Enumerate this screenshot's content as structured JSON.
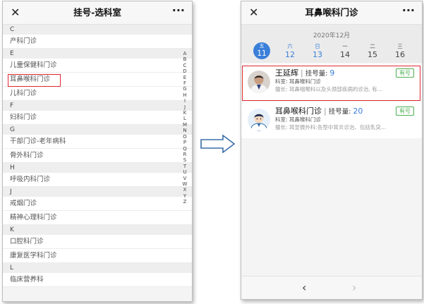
{
  "left": {
    "title": "挂号-选科室",
    "close_icon": "✕",
    "more_icon": "···",
    "rows": [
      {
        "kind": "letter",
        "text": "C"
      },
      {
        "kind": "dept",
        "text": "产科门诊"
      },
      {
        "kind": "letter",
        "text": "E"
      },
      {
        "kind": "dept",
        "text": "儿童保健科门诊"
      },
      {
        "kind": "dept",
        "text": "耳鼻喉科门诊",
        "highlighted": true
      },
      {
        "kind": "dept",
        "text": "儿科门诊"
      },
      {
        "kind": "letter",
        "text": "F"
      },
      {
        "kind": "dept",
        "text": "妇科门诊"
      },
      {
        "kind": "letter",
        "text": "G"
      },
      {
        "kind": "dept",
        "text": "干部门诊-老年病科"
      },
      {
        "kind": "dept",
        "text": "骨外科门诊"
      },
      {
        "kind": "letter",
        "text": "H"
      },
      {
        "kind": "dept",
        "text": "呼吸内科门诊"
      },
      {
        "kind": "letter",
        "text": "J"
      },
      {
        "kind": "dept",
        "text": "戒烟门诊"
      },
      {
        "kind": "dept",
        "text": "精神心理科门诊"
      },
      {
        "kind": "letter",
        "text": "K"
      },
      {
        "kind": "dept",
        "text": "口腔科门诊"
      },
      {
        "kind": "dept",
        "text": "康复医学科门诊"
      },
      {
        "kind": "letter",
        "text": "L"
      },
      {
        "kind": "dept",
        "text": "临床营养科"
      }
    ],
    "alphabet": [
      "A",
      "B",
      "C",
      "D",
      "E",
      "F",
      "G",
      "H",
      "I",
      "J",
      "K",
      "L",
      "M",
      "N",
      "O",
      "P",
      "Q",
      "R",
      "S",
      "T",
      "U",
      "V",
      "W",
      "X",
      "Y",
      "Z"
    ]
  },
  "right": {
    "title": "耳鼻喉科门诊",
    "close_icon": "✕",
    "more_icon": "···",
    "year_month": "2020年12月",
    "days": [
      {
        "weekday": "五",
        "date": "11",
        "state": "active"
      },
      {
        "weekday": "六",
        "date": "12",
        "state": "blue"
      },
      {
        "weekday": "日",
        "date": "13",
        "state": "blue"
      },
      {
        "weekday": "一",
        "date": "14",
        "state": "dark"
      },
      {
        "weekday": "二",
        "date": "15",
        "state": "dark"
      },
      {
        "weekday": "三",
        "date": "16",
        "state": "dark"
      }
    ],
    "doctors": [
      {
        "name": "王延辉",
        "quota_label": "挂号量:",
        "quota": "9",
        "badge": "有号",
        "dept": "科室: 耳鼻喉科门诊",
        "specialty": "擅长: 耳鼻咽喉科以及头颈部疾病的诊治, 有..."
      },
      {
        "name": "耳鼻喉科门诊",
        "quota_label": "挂号量:",
        "quota": "20",
        "badge": "有号",
        "dept": "科室: 耳鼻喉科门诊",
        "specialty": "擅长: 耳显微外科:各型中耳炎诊治、包括乳突..."
      }
    ],
    "back_icon": "‹",
    "forward_icon": "›"
  },
  "colors": {
    "highlight": "#e0262f",
    "accent": "#3a7fd9",
    "available": "#4caf50"
  }
}
